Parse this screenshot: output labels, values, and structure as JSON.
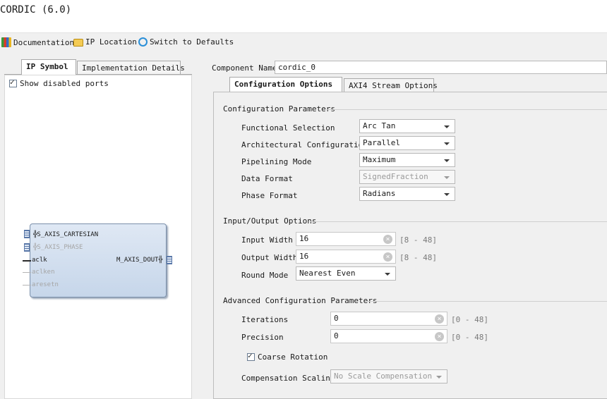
{
  "window": {
    "title": "CORDIC (6.0)"
  },
  "toolbar": {
    "documentation": "Documentation",
    "ip_location": "IP Location",
    "switch_defaults": "Switch to Defaults"
  },
  "left_tabs": {
    "ip_symbol": "IP Symbol",
    "impl_details": "Implementation Details"
  },
  "show_disabled_ports": {
    "label": "Show disabled ports",
    "checked": true
  },
  "symbol": {
    "ports_left": [
      "S_AXIS_CARTESIAN",
      "S_AXIS_PHASE",
      "aclk",
      "aclken",
      "aresetn"
    ],
    "ports_right": [
      "M_AXIS_DOUT"
    ]
  },
  "component": {
    "label": "Component Name",
    "value": "cordic_0"
  },
  "right_tabs": {
    "config": "Configuration Options",
    "axi4": "AXI4 Stream Options"
  },
  "config_params": {
    "title": "Configuration Parameters",
    "functional_selection": {
      "label": "Functional Selection",
      "value": "Arc Tan"
    },
    "architectural_config": {
      "label": "Architectural Configuration",
      "value": "Parallel"
    },
    "pipelining_mode": {
      "label": "Pipelining Mode",
      "value": "Maximum"
    },
    "data_format": {
      "label": "Data Format",
      "value": "SignedFraction"
    },
    "phase_format": {
      "label": "Phase Format",
      "value": "Radians"
    }
  },
  "io_options": {
    "title": "Input/Output Options",
    "input_width": {
      "label": "Input Width",
      "value": "16",
      "range": "[8 - 48]"
    },
    "output_width": {
      "label": "Output Width",
      "value": "16",
      "range": "[8 - 48]"
    },
    "round_mode": {
      "label": "Round Mode",
      "value": "Nearest Even"
    }
  },
  "advanced": {
    "title": "Advanced Configuration Parameters",
    "iterations": {
      "label": "Iterations",
      "value": "0",
      "range": "[0 - 48]"
    },
    "precision": {
      "label": "Precision",
      "value": "0",
      "range": "[0 - 48]"
    },
    "coarse_rotation": {
      "label": "Coarse Rotation",
      "checked": true
    },
    "compensation_scaling": {
      "label": "Compensation Scaling",
      "value": "No Scale Compensation"
    }
  }
}
